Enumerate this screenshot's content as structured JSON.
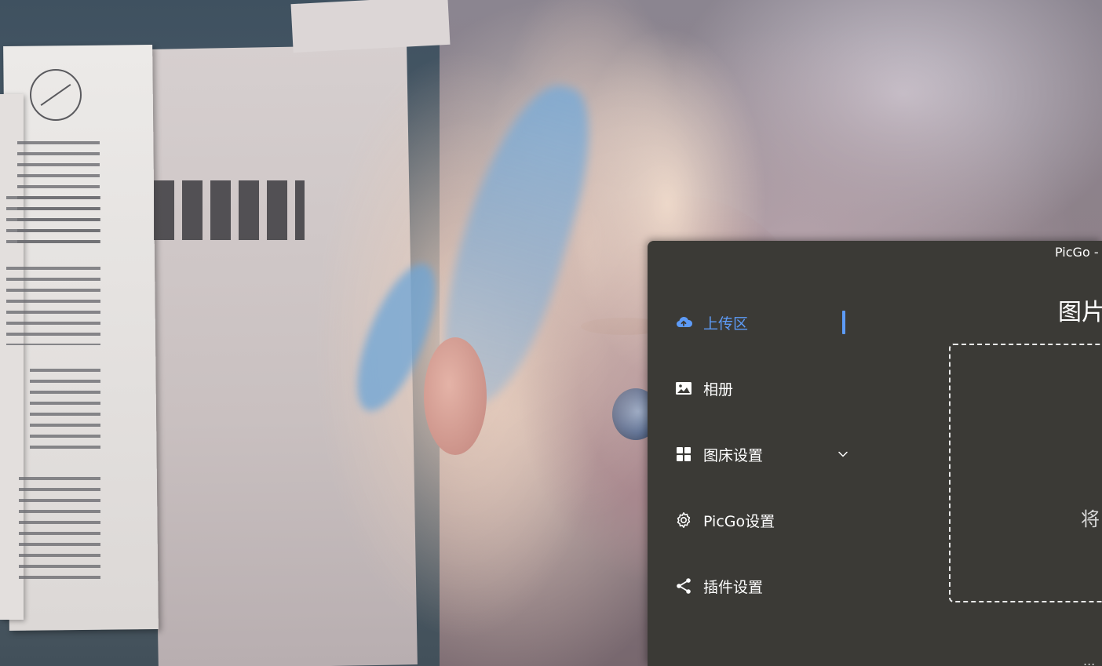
{
  "window": {
    "title": "PicGo -"
  },
  "sidebar": {
    "items": [
      {
        "label": "上传区",
        "icon": "cloud-upload-icon",
        "active": true
      },
      {
        "label": "相册",
        "icon": "image-icon",
        "active": false
      },
      {
        "label": "图床设置",
        "icon": "grid-icon",
        "active": false,
        "expandable": true
      },
      {
        "label": "PicGo设置",
        "icon": "gear-icon",
        "active": false
      },
      {
        "label": "插件设置",
        "icon": "share-icon",
        "active": false
      }
    ]
  },
  "main": {
    "title": "图片",
    "drop_hint": "将",
    "footer_hint": "..."
  },
  "colors": {
    "window_background": "#3b3a36",
    "accent": "#5d9bf7",
    "text": "#ffffff"
  }
}
